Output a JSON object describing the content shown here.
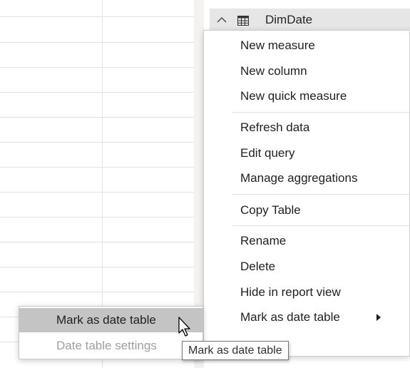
{
  "fields_pane": {
    "table_name": "DimDate",
    "collapse_icon": "chevron-up-icon",
    "table_icon": "table-icon"
  },
  "context_menu": {
    "groups": [
      [
        "New measure",
        "New column",
        "New quick measure"
      ],
      [
        "Refresh data",
        "Edit query",
        "Manage aggregations"
      ],
      [
        "Copy Table"
      ],
      [
        "Rename",
        "Delete",
        "Hide in report view",
        "Mark as date table"
      ]
    ],
    "submenu_arrow_icon": "caret-right-icon"
  },
  "submenu": {
    "items": [
      "Mark as date table",
      "Date table settings"
    ],
    "hovered_index": 0,
    "disabled_index": 1
  },
  "tooltip": {
    "text": "Mark as date table"
  },
  "cursor_icon": "mouse-pointer-icon",
  "colors": {
    "header_bg": "#e6e6e6",
    "hover_bg": "#c4c4c4",
    "disabled_text": "#a19f9d",
    "gridline": "#e1e1e1"
  }
}
